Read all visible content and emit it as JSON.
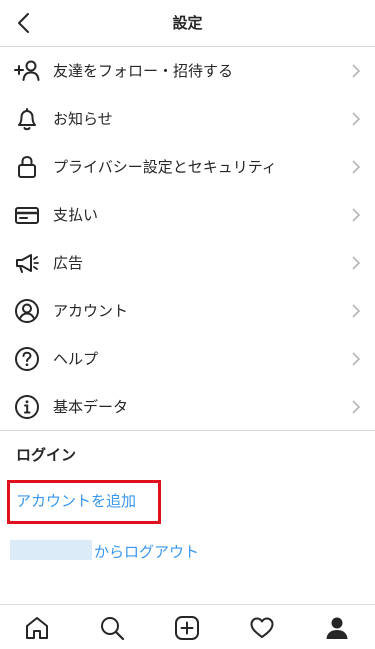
{
  "header": {
    "title": "設定",
    "back_icon": "chevron-left-icon"
  },
  "menu": [
    {
      "label": "友達をフォロー・招待する",
      "icon": "add-person-icon"
    },
    {
      "label": "お知らせ",
      "icon": "bell-icon"
    },
    {
      "label": "プライバシー設定とセキュリティ",
      "icon": "lock-icon"
    },
    {
      "label": "支払い",
      "icon": "card-icon"
    },
    {
      "label": "広告",
      "icon": "megaphone-icon"
    },
    {
      "label": "アカウント",
      "icon": "account-icon"
    },
    {
      "label": "ヘルプ",
      "icon": "help-icon"
    },
    {
      "label": "基本データ",
      "icon": "info-icon"
    }
  ],
  "login": {
    "section_title": "ログイン",
    "add_account": "アカウントを追加",
    "logout": "からログアウト"
  },
  "bottom_nav": [
    "home-icon",
    "search-icon",
    "new-post-icon",
    "heart-icon",
    "profile-icon"
  ],
  "colors": {
    "link": "#3897f0",
    "highlight": "#e0101f",
    "divider": "#dbdbdb"
  }
}
